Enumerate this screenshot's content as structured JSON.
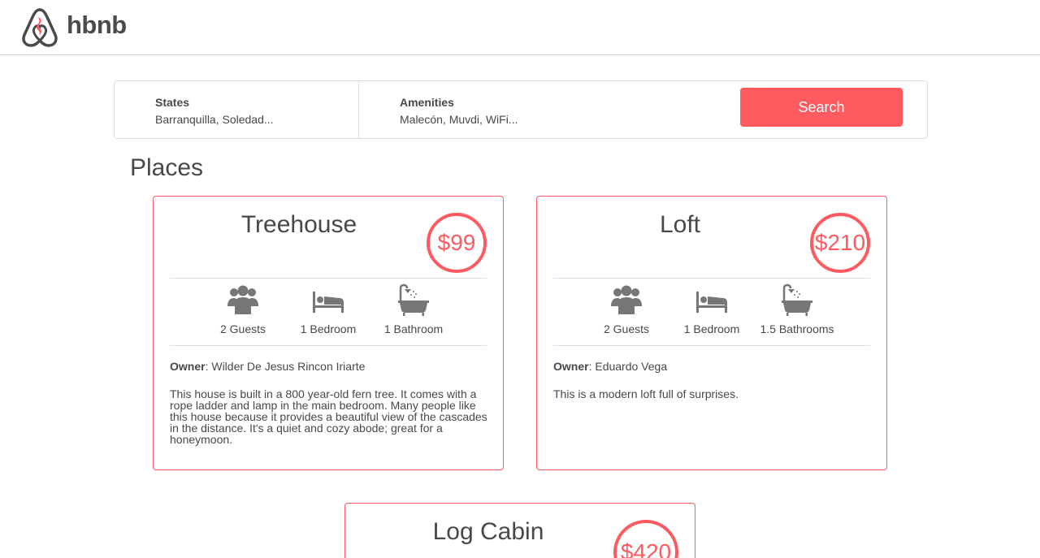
{
  "header": {
    "brand": "hbnb",
    "logo_icon": "airbnb-logo-icon"
  },
  "filters": {
    "states": {
      "title": "States",
      "value": "Barranquilla, Soledad..."
    },
    "amenities": {
      "title": "Amenities",
      "value": "Malecón, Muvdi, WiFi..."
    },
    "search_label": "Search"
  },
  "places": {
    "title": "Places",
    "items": [
      {
        "name": "Treehouse",
        "price": "$99",
        "guests": "2 Guests",
        "bedrooms": "1 Bedroom",
        "bathrooms": "1 Bathroom",
        "owner_label": "Owner",
        "owner": ": Wilder De Jesus Rincon Iriarte",
        "description": "This house is built in a 800 year-old fern tree. It comes with a rope ladder and lamp in the main bedroom. Many people like this house because it provides a beautiful view of the cascades in the distance. It's a quiet and cozy abode; great for a honeymoon."
      },
      {
        "name": "Loft",
        "price": "$210",
        "guests": "2 Guests",
        "bedrooms": "1 Bedroom",
        "bathrooms": "1.5 Bathrooms",
        "owner_label": "Owner",
        "owner": ": Eduardo Vega",
        "description": "This is a modern loft full of surprises."
      },
      {
        "name": "Log Cabin",
        "price": "$420"
      }
    ]
  },
  "colors": {
    "accent": "#ff5a5f",
    "text": "#484848",
    "icon": "#767676",
    "border": "#dddddd"
  }
}
